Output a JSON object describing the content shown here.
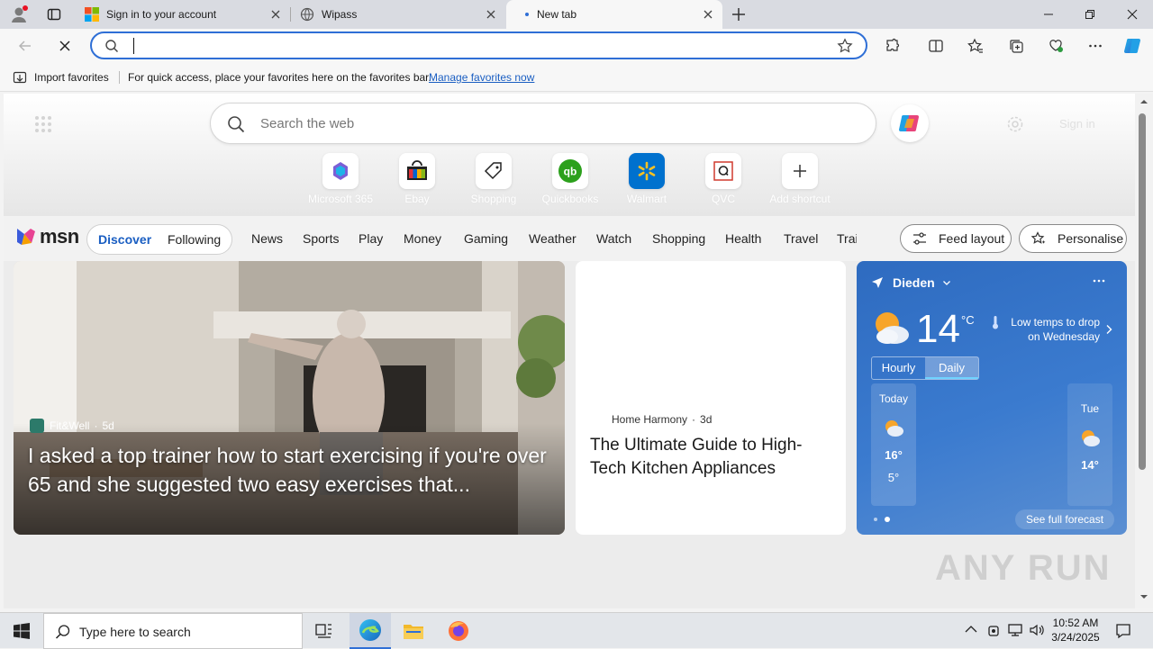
{
  "tabs": [
    {
      "title": "Sign in to your account"
    },
    {
      "title": "Wipass"
    },
    {
      "title": "New tab"
    }
  ],
  "favorites_bar": {
    "import_label": "Import favorites",
    "hint": "For quick access, place your favorites here on the favorites bar.",
    "manage_link": "Manage favorites now"
  },
  "address_bar": {
    "value": ""
  },
  "newtab": {
    "search_placeholder": "Search the web",
    "signin_label": "Sign in",
    "shortcuts": [
      {
        "label": "Microsoft 365"
      },
      {
        "label": "Ebay"
      },
      {
        "label": "Shopping"
      },
      {
        "label": "Quickbooks"
      },
      {
        "label": "Walmart"
      },
      {
        "label": "QVC"
      },
      {
        "label": "Add shortcut"
      }
    ]
  },
  "msn_nav": {
    "logo": "msn",
    "discover": "Discover",
    "following": "Following",
    "items": [
      "News",
      "Sports",
      "Play",
      "Money",
      "Gaming",
      "Weather",
      "Watch",
      "Shopping",
      "Health",
      "Travel",
      "Trai"
    ],
    "feed_layout": "Feed layout",
    "personalise": "Personalise"
  },
  "cards": {
    "main": {
      "source": "Fit&Well",
      "age": "5d",
      "headline": "I asked a top trainer how to start exercising if you're over 65 and she suggested two easy exercises that..."
    },
    "second": {
      "source": "Home Harmony",
      "age": "3d",
      "headline": "The Ultimate Guide to High-Tech Kitchen Appliances"
    }
  },
  "weather": {
    "location": "Dieden",
    "temp": "14",
    "unit": "°C",
    "alert": "Low temps to drop on Wednesday",
    "tab_hourly": "Hourly",
    "tab_daily": "Daily",
    "days": [
      {
        "day": "Today",
        "high": "16°",
        "low": "5°"
      },
      {
        "day": "Tue",
        "high": "14°"
      }
    ],
    "see_full": "See full forecast"
  },
  "watermark": "ANY RUN",
  "taskbar": {
    "search_placeholder": "Type here to search",
    "time": "10:52 AM",
    "date": "3/24/2025"
  },
  "colors": {
    "accent": "#2f6fd6",
    "weather_bg": "#2f6ab8",
    "taskbar": "#e3e6ea"
  }
}
